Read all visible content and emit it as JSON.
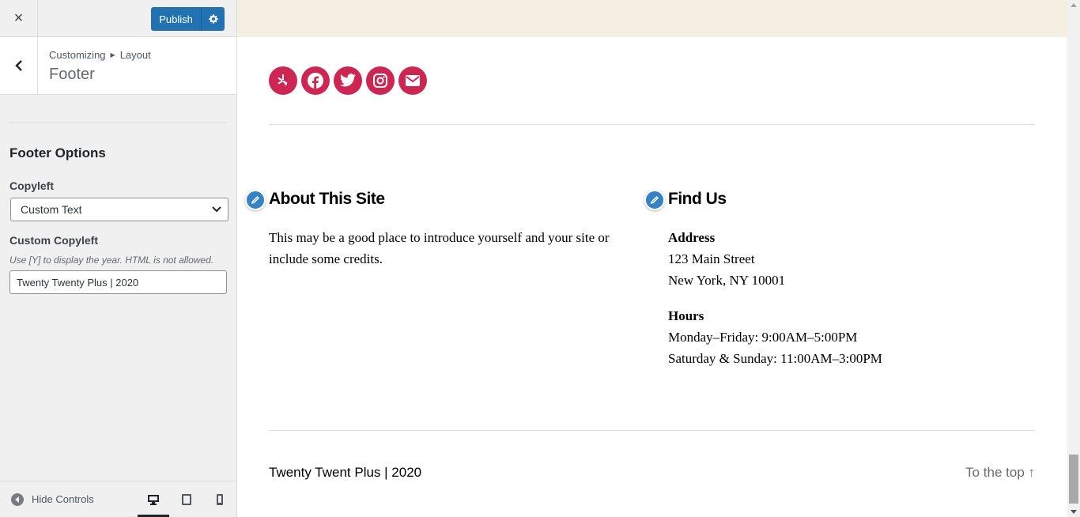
{
  "customizer": {
    "close_label": "×",
    "publish_label": "Publish",
    "breadcrumb_root": "Customizing",
    "breadcrumb_section": "Layout",
    "section_title": "Footer",
    "options_heading": "Footer Options",
    "copyleft_label": "Copyleft",
    "copyleft_selected": "Custom Text",
    "custom_copyleft_label": "Custom Copyleft",
    "custom_copyleft_description": "Use [Y] to display the year. HTML is not allowed.",
    "custom_copyleft_value": "Twenty Twenty Plus | 2020",
    "hide_controls_label": "Hide Controls",
    "active_device": "desktop"
  },
  "colors": {
    "accent": "#cd2653",
    "wp_blue": "#2271b1",
    "header_strip": "#f4efe1"
  },
  "preview": {
    "social_icons": [
      "yelp-icon",
      "facebook-icon",
      "twitter-icon",
      "instagram-icon",
      "mail-icon"
    ],
    "about": {
      "title": "About This Site",
      "text": "This may be a good place to introduce yourself and your site or include some credits."
    },
    "find_us": {
      "title": "Find Us",
      "address_heading": "Address",
      "address_line1": "123 Main Street",
      "address_line2": "New York, NY 10001",
      "hours_heading": "Hours",
      "hours_line1": "Monday–Friday: 9:00AM–5:00PM",
      "hours_line2": "Saturday & Sunday: 11:00AM–3:00PM"
    },
    "copyright": "Twenty Twent Plus | 2020",
    "to_top": "To the top ↑"
  }
}
